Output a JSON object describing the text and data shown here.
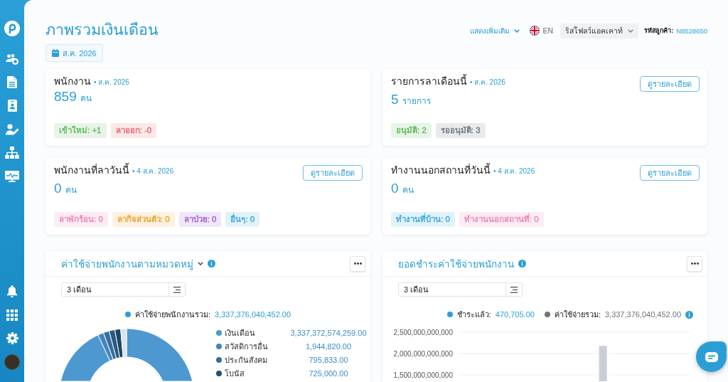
{
  "header": {
    "title": "ภาพรวมเงินเดือน",
    "period": "ส.ค. 2026",
    "show_more": "แสดงเพิ่มเติม",
    "language": "EN",
    "account": "ริสโฟลว์แอคเคาท์",
    "customer_id_label": "รหัสลูกค้า:",
    "customer_id": "N8528650"
  },
  "summary_cards": [
    {
      "title": "พนักงาน",
      "date": "• ส.ค. 2026",
      "value": "859",
      "unit": "คน",
      "tags": [
        {
          "label": "เข้าใหม่: +1",
          "color": "#5cb85c"
        },
        {
          "label": "ลาออก: -0",
          "color": "#e5636f"
        }
      ]
    },
    {
      "title": "รายการลาเดือนนี้",
      "date": "• ส.ค. 2026",
      "button": "ดูรายละเอียด",
      "value": "5",
      "unit": "รายการ",
      "tags": [
        {
          "label": "อนุมัติ: 2",
          "color": "#5cb85c"
        },
        {
          "label": "รออนุมัติ: 3",
          "color": "#6c757d"
        }
      ]
    },
    {
      "title": "พนักงานที่ลาวันนี้",
      "date": "• 4 ส.ค. 2026",
      "button": "ดูรายละเอียด",
      "value": "0",
      "unit": "คน",
      "tags": [
        {
          "label": "ลาพักร้อน: 0",
          "color": "#ee7fb5"
        },
        {
          "label": "ลากิจส่วนตัว: 0",
          "color": "#f0a02b"
        },
        {
          "label": "ลาป่วย: 0",
          "color": "#9b5ad8"
        },
        {
          "label": "อื่นๆ: 0",
          "color": "#36a6d9"
        }
      ]
    },
    {
      "title": "ทำงานนอกสถานที่วันนี้",
      "date": "• 4 ส.ค. 2026",
      "button": "ดูรายละเอียด",
      "value": "0",
      "unit": "คน",
      "tags": [
        {
          "label": "ทำงานที่บ้าน: 0",
          "color": "#36a6d9"
        },
        {
          "label": "ทำงานนอกสถานที่: 0",
          "color": "#ee7fb5"
        }
      ]
    }
  ],
  "chart_panels": [
    {
      "kind": "donut",
      "title": "ค่าใช้จ่ายพนักงานตามหมวดหมู่",
      "expandable": true,
      "range": "3 เดือน",
      "legend": [
        {
          "label": "ค่าใช้จ่ายพนักงานรวม:",
          "value": "3,337,376,040,452.00",
          "color": "#2b9fd5",
          "info": false
        }
      ],
      "categories": [
        {
          "label": "เงินเดือน",
          "value": "3,337,372,574,259.00",
          "color": "#4d98d1"
        },
        {
          "label": "สวัสดิการอื่น",
          "value": "1,944,820.00",
          "color": "#3f85bb"
        },
        {
          "label": "ประกันสังคม",
          "value": "795,833.00",
          "color": "#316d9a"
        },
        {
          "label": "โบนัส",
          "value": "725,000.00",
          "color": "#244f73"
        }
      ]
    },
    {
      "kind": "bar",
      "title": "ยอดชำระค่าใช้จ่ายพนักงาน",
      "expandable": false,
      "range": "3 เดือน",
      "legend": [
        {
          "label": "ชำระแล้ว:",
          "value": "470,705.00",
          "color": "#2b9fd5",
          "info": false
        },
        {
          "label": "ค่าใช้จ่ายรวม:",
          "value": "3,337,376,040,452.00",
          "color": "#6c757d",
          "info": true
        }
      ],
      "chart_data": {
        "type": "bar",
        "ylim": [
          1350000000000,
          2500000000000
        ],
        "yticks": [
          {
            "value": 2500000000000,
            "label": "2,500,000,000,000"
          },
          {
            "value": 2000000000000,
            "label": "2,000,000,000,000"
          },
          {
            "value": 1500000000000,
            "label": "1,500,000,000,000"
          }
        ],
        "series": [
          {
            "color": "#c9ced6",
            "values": [
              null,
              null,
              2180000000000,
              null
            ]
          }
        ]
      }
    }
  ]
}
